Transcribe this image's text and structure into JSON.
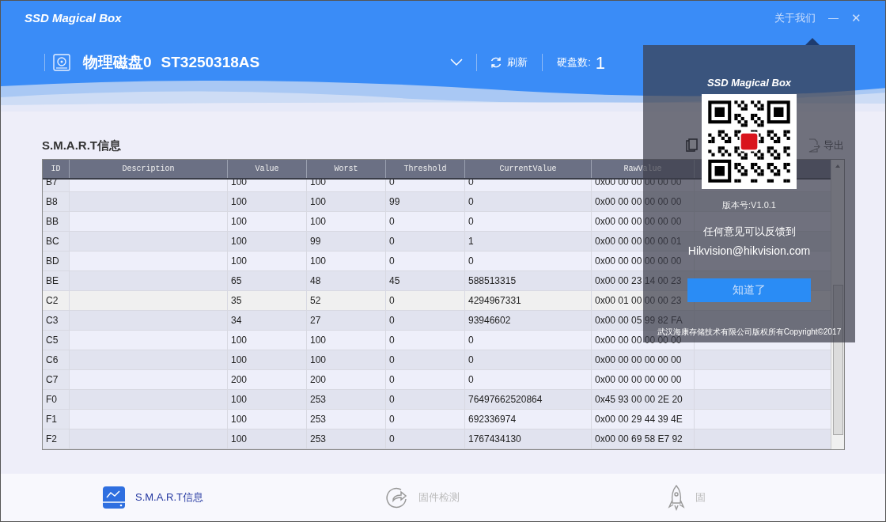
{
  "window": {
    "title": "SSD Magical Box",
    "about": "关于我们",
    "minimize": "—",
    "close": "✕"
  },
  "drive": {
    "name": "物理磁盘0",
    "model": "ST3250318AS",
    "refresh": "刷新",
    "count_label": "硬盘数:",
    "count": "1"
  },
  "section": {
    "title": "S.M.A.R.T信息",
    "export": "导出"
  },
  "table": {
    "columns": [
      "ID",
      "Description",
      "Value",
      "Worst",
      "Threshold",
      "CurrentValue",
      "RawValue"
    ],
    "rows": [
      {
        "id": "B7",
        "description": "",
        "value": "100",
        "worst": "100",
        "threshold": "0",
        "current": "0",
        "raw": "0x00 00 00 00 00 00",
        "selected": false
      },
      {
        "id": "B8",
        "description": "",
        "value": "100",
        "worst": "100",
        "threshold": "99",
        "current": "0",
        "raw": "0x00 00 00 00 00 00",
        "selected": false
      },
      {
        "id": "BB",
        "description": "",
        "value": "100",
        "worst": "100",
        "threshold": "0",
        "current": "0",
        "raw": "0x00 00 00 00 00 00",
        "selected": false
      },
      {
        "id": "BC",
        "description": "",
        "value": "100",
        "worst": "99",
        "threshold": "0",
        "current": "1",
        "raw": "0x00 00 00 00 00 01",
        "selected": false
      },
      {
        "id": "BD",
        "description": "",
        "value": "100",
        "worst": "100",
        "threshold": "0",
        "current": "0",
        "raw": "0x00 00 00 00 00 00",
        "selected": false
      },
      {
        "id": "BE",
        "description": "",
        "value": "65",
        "worst": "48",
        "threshold": "45",
        "current": "588513315",
        "raw": "0x00 00 23 14 00 23",
        "selected": false
      },
      {
        "id": "C2",
        "description": "",
        "value": "35",
        "worst": "52",
        "threshold": "0",
        "current": "4294967331",
        "raw": "0x00 01 00 00 00 23",
        "selected": true
      },
      {
        "id": "C3",
        "description": "",
        "value": "34",
        "worst": "27",
        "threshold": "0",
        "current": "93946602",
        "raw": "0x00 00 05 99 82 FA",
        "selected": false
      },
      {
        "id": "C5",
        "description": "",
        "value": "100",
        "worst": "100",
        "threshold": "0",
        "current": "0",
        "raw": "0x00 00 00 00 00 00",
        "selected": false
      },
      {
        "id": "C6",
        "description": "",
        "value": "100",
        "worst": "100",
        "threshold": "0",
        "current": "0",
        "raw": "0x00 00 00 00 00 00",
        "selected": false
      },
      {
        "id": "C7",
        "description": "",
        "value": "200",
        "worst": "200",
        "threshold": "0",
        "current": "0",
        "raw": "0x00 00 00 00 00 00",
        "selected": false
      },
      {
        "id": "F0",
        "description": "",
        "value": "100",
        "worst": "253",
        "threshold": "0",
        "current": "76497662520864",
        "raw": "0x45 93 00 00 2E 20",
        "selected": false
      },
      {
        "id": "F1",
        "description": "",
        "value": "100",
        "worst": "253",
        "threshold": "0",
        "current": "692336974",
        "raw": "0x00 00 29 44 39 4E",
        "selected": false
      },
      {
        "id": "F2",
        "description": "",
        "value": "100",
        "worst": "253",
        "threshold": "0",
        "current": "1767434130",
        "raw": "0x00 00 69 58 E7 92",
        "selected": false
      }
    ]
  },
  "about_popup": {
    "title": "SSD Magical Box",
    "version": "版本号:V1.0.1",
    "feedback": "任何意见可以反馈到",
    "email": "Hikvision@hikvision.com",
    "ok": "知道了",
    "copyright": "武汉海康存储技术有限公司版权所有Copyright©2017"
  },
  "bottom_tabs": [
    {
      "kind": "smart",
      "label": "S.M.A.R.T信息",
      "selected": true
    },
    {
      "kind": "firmware",
      "label": "固件检测",
      "selected": false
    },
    {
      "kind": "rocket",
      "label": "固",
      "selected": false
    }
  ]
}
